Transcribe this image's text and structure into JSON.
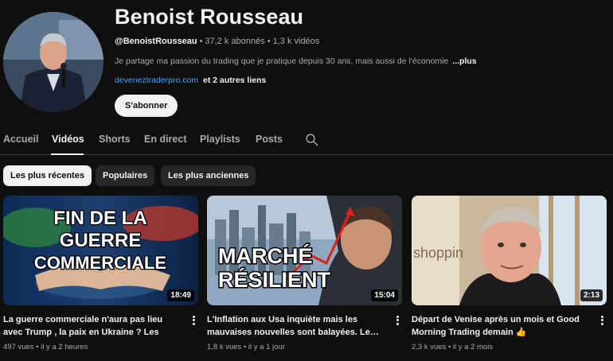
{
  "channel": {
    "name": "Benoist Rousseau",
    "handle": "@BenoistRousseau",
    "subscribers": "37,2 k abonnés",
    "videos_count": "1,3 k vidéos",
    "separator": "•",
    "description": "Je partage ma passion du trading que je pratique depuis 30 ans, mais aussi de l'économie",
    "more_label": "...plus",
    "link": "deveneztraderpro.com",
    "other_links": "et 2 autres liens",
    "subscribe_label": "S'abonner"
  },
  "tabs": [
    {
      "label": "Accueil",
      "active": false
    },
    {
      "label": "Vidéos",
      "active": true
    },
    {
      "label": "Shorts",
      "active": false
    },
    {
      "label": "En direct",
      "active": false
    },
    {
      "label": "Playlists",
      "active": false
    },
    {
      "label": "Posts",
      "active": false
    }
  ],
  "search_icon": "search-icon",
  "chips": [
    {
      "label": "Les plus récentes",
      "active": true
    },
    {
      "label": "Populaires",
      "active": false
    },
    {
      "label": "Les plus anciennes",
      "active": false
    }
  ],
  "videos": [
    {
      "title": "La guerre commerciale n'aura pas lieu avec Trump , la paix en Ukraine ? Les Bourses…",
      "views": "497 vues",
      "age": "il y a 2 heures",
      "duration": "18:49",
      "thumb_text": [
        "FIN DE LA",
        "GUERRE",
        "COMMERCIALE"
      ]
    },
    {
      "title": "L'Inflation aux Usa inquiète mais les mauvaises nouvelles sont balayées. Le…",
      "views": "1,8 k vues",
      "age": "il y a 1 jour",
      "duration": "15:04",
      "thumb_text": [
        "MARCHÉ",
        "RÉSILIENT"
      ]
    },
    {
      "title": "Départ de Venise après un mois et Good Morning Trading demain 👍",
      "views": "2,3 k vues",
      "age": "il y a 2 mois",
      "duration": "2:13",
      "thumb_text": [
        "shoppin"
      ]
    }
  ],
  "colors": {
    "background": "#0f0f0f",
    "text_primary": "#f1f1f1",
    "text_secondary": "#aaaaaa",
    "link": "#3ea6ff",
    "chip_bg": "#272727"
  }
}
